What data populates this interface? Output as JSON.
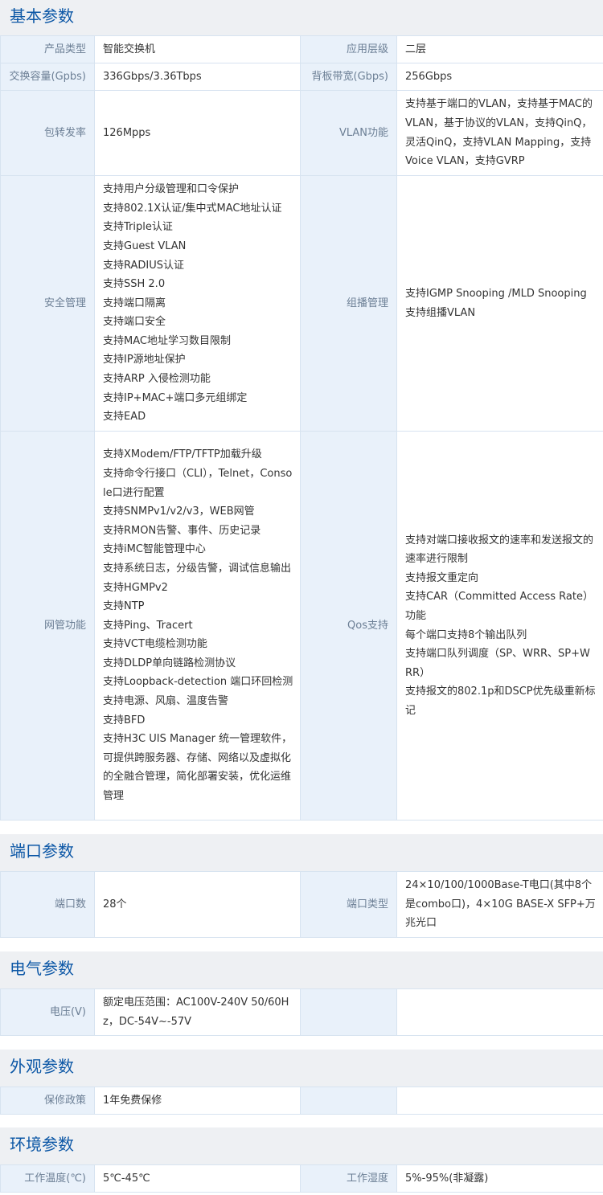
{
  "sections": {
    "basic": {
      "title": "基本参数",
      "rows": [
        {
          "l1": "产品类型",
          "v1": [
            "智能交换机"
          ],
          "l2": "应用层级",
          "v2": [
            "二层"
          ]
        },
        {
          "l1": "交换容量(Gpbs)",
          "v1": [
            "336Gbps/3.36Tbps"
          ],
          "l2": "背板带宽(Gbps)",
          "v2": [
            "256Gbps"
          ]
        },
        {
          "l1": "包转发率",
          "v1": [
            "126Mpps"
          ],
          "l2": "VLAN功能",
          "v2": [
            "支持基于端口的VLAN，支持基于MAC的VLAN，基于协议的VLAN，支持QinQ，灵活QinQ，支持VLAN Mapping，支持Voice VLAN，支持GVRP"
          ]
        },
        {
          "l1": "安全管理",
          "v1": [
            "支持用户分级管理和口令保护",
            "支持802.1X认证/集中式MAC地址认证",
            "支持Triple认证",
            "支持Guest VLAN",
            "支持RADIUS认证",
            "支持SSH 2.0",
            "支持端口隔离",
            "支持端口安全",
            "支持MAC地址学习数目限制",
            "支持IP源地址保护",
            "支持ARP 入侵检测功能",
            "支持IP+MAC+端口多元组绑定",
            "支持EAD"
          ],
          "l2": "组播管理",
          "v2": [
            "支持IGMP Snooping /MLD Snooping",
            "支持组播VLAN"
          ]
        },
        {
          "l1": "网管功能",
          "v1": [
            "支持XModem/FTP/TFTP加载升级",
            "支持命令行接口（CLI），Telnet，Console口进行配置",
            "支持SNMPv1/v2/v3，WEB网管",
            "支持RMON告警、事件、历史记录",
            "支持iMC智能管理中心",
            "支持系统日志，分级告警，调试信息输出",
            "支持HGMPv2",
            "支持NTP",
            "支持Ping、Tracert",
            "支持VCT电缆检测功能",
            "支持DLDP单向链路检测协议",
            "支持Loopback-detection 端口环回检测",
            "支持电源、风扇、温度告警",
            "支持BFD",
            "支持H3C UIS Manager 统一管理软件，可提供跨服务器、存储、网络以及虚拟化的全融合管理，简化部署安装，优化运维管理"
          ],
          "l2": "Qos支持",
          "v2": [
            "支持对端口接收报文的速率和发送报文的速率进行限制",
            "支持报文重定向",
            "支持CAR（Committed Access Rate）功能",
            "每个端口支持8个输出队列",
            "支持端口队列调度（SP、WRR、SP+WRR）",
            "支持报文的802.1p和DSCP优先级重新标记"
          ]
        }
      ]
    },
    "port": {
      "title": "端口参数",
      "rows": [
        {
          "l1": "端口数",
          "v1": [
            "28个"
          ],
          "l2": "端口类型",
          "v2": [
            "24×10/100/1000Base-T电口(其中8个是combo口)，4×10G BASE-X SFP+万兆光口"
          ]
        }
      ]
    },
    "power": {
      "title": "电气参数",
      "rows": [
        {
          "l1": "电压(V)",
          "v1": [
            "额定电压范围：AC100V-240V 50/60Hz，DC-54V~-57V"
          ],
          "l2": "",
          "v2": []
        }
      ]
    },
    "appearance": {
      "title": "外观参数",
      "rows": [
        {
          "l1": "保修政策",
          "v1": [
            "1年免费保修"
          ],
          "l2": "",
          "v2": []
        }
      ]
    },
    "env": {
      "title": "环境参数",
      "rows": [
        {
          "l1": "工作温度(℃)",
          "v1": [
            "5℃-45℃"
          ],
          "l2": "工作湿度",
          "v2": [
            "5%-95%(非凝露)"
          ]
        }
      ]
    }
  }
}
